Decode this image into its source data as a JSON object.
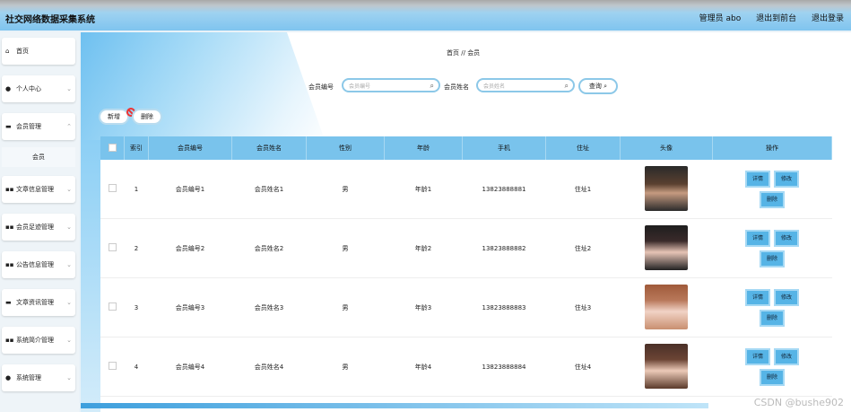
{
  "header": {
    "app_title": "社交网络数据采集系统",
    "admin_label": "管理员 abo",
    "exit_to_front": "退出到前台",
    "logout": "退出登录"
  },
  "sidebar": {
    "items": [
      {
        "label": "首页",
        "icon": "home-icon"
      },
      {
        "label": "个人中心",
        "icon": "user-icon"
      },
      {
        "label": "会员管理",
        "icon": "monitor-icon"
      },
      {
        "label": "文章信息管理",
        "icon": "grid-icon"
      },
      {
        "label": "会员足迹管理",
        "icon": "grid-icon"
      },
      {
        "label": "公告信息管理",
        "icon": "grid-icon"
      },
      {
        "label": "文章资讯管理",
        "icon": "monitor-icon"
      },
      {
        "label": "系统简介管理",
        "icon": "grid-icon"
      },
      {
        "label": "系统管理",
        "icon": "pin-icon"
      }
    ],
    "sub_item": "会员"
  },
  "breadcrumb": {
    "home": "首页",
    "sep": "//",
    "current": "会员"
  },
  "search": {
    "label1": "会员编号",
    "placeholder1": "会员编号",
    "label2": "会员姓名",
    "placeholder2": "会员姓名",
    "query_btn": "查询"
  },
  "ops": {
    "add": "新增",
    "delete": "删除"
  },
  "table": {
    "headers": [
      "索引",
      "会员编号",
      "会员姓名",
      "性别",
      "年龄",
      "手机",
      "住址",
      "头像",
      "操作"
    ],
    "rows": [
      {
        "idx": "1",
        "no": "会员编号1",
        "name": "会员姓名1",
        "gender": "男",
        "age": "年龄1",
        "phone": "13823888881",
        "addr": "住址1",
        "actions": [
          "详情",
          "修改",
          "删除"
        ]
      },
      {
        "idx": "2",
        "no": "会员编号2",
        "name": "会员姓名2",
        "gender": "男",
        "age": "年龄2",
        "phone": "13823888882",
        "addr": "住址2",
        "actions": [
          "详情",
          "修改",
          "删除"
        ]
      },
      {
        "idx": "3",
        "no": "会员编号3",
        "name": "会员姓名3",
        "gender": "男",
        "age": "年龄3",
        "phone": "13823888883",
        "addr": "住址3",
        "actions": [
          "详情",
          "修改",
          "删除"
        ]
      },
      {
        "idx": "4",
        "no": "会员编号4",
        "name": "会员姓名4",
        "gender": "男",
        "age": "年龄4",
        "phone": "13823888884",
        "addr": "住址4",
        "actions": [
          "详情",
          "修改",
          "删除"
        ]
      }
    ]
  },
  "watermark": "CSDN @bushe902",
  "colors": {
    "accent": "#79c3ec",
    "button": "#56b4e6"
  }
}
